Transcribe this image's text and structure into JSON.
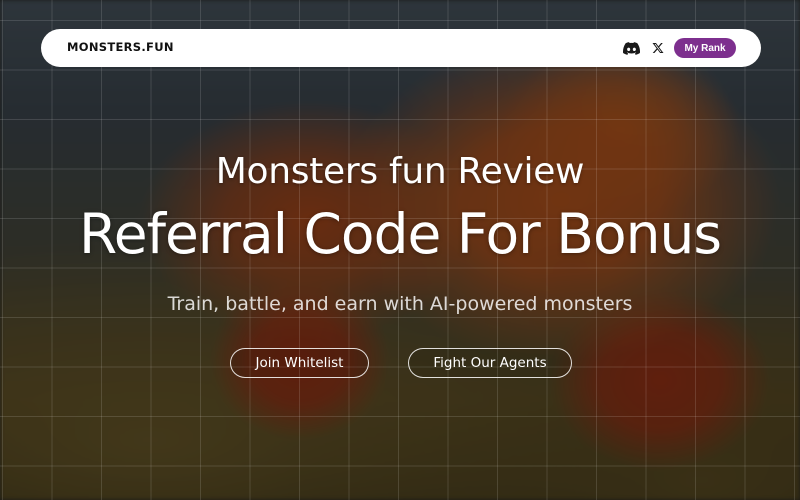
{
  "navbar": {
    "logo": "MONSTERS.FUN",
    "icons": [
      "discord-icon",
      "x-icon"
    ],
    "rank_button_label": "My Rank"
  },
  "hero": {
    "subtitle": "Monsters fun Review",
    "title": "Referral Code For Bonus",
    "tagline": "Train, battle, and earn with AI-powered monsters"
  },
  "actions": {
    "join_label": "Join Whitelist",
    "fight_label": "Fight Our Agents"
  },
  "colors": {
    "accent": "#7d2f8e",
    "navbar_bg": "#ffffff",
    "text": "#ffffff"
  }
}
